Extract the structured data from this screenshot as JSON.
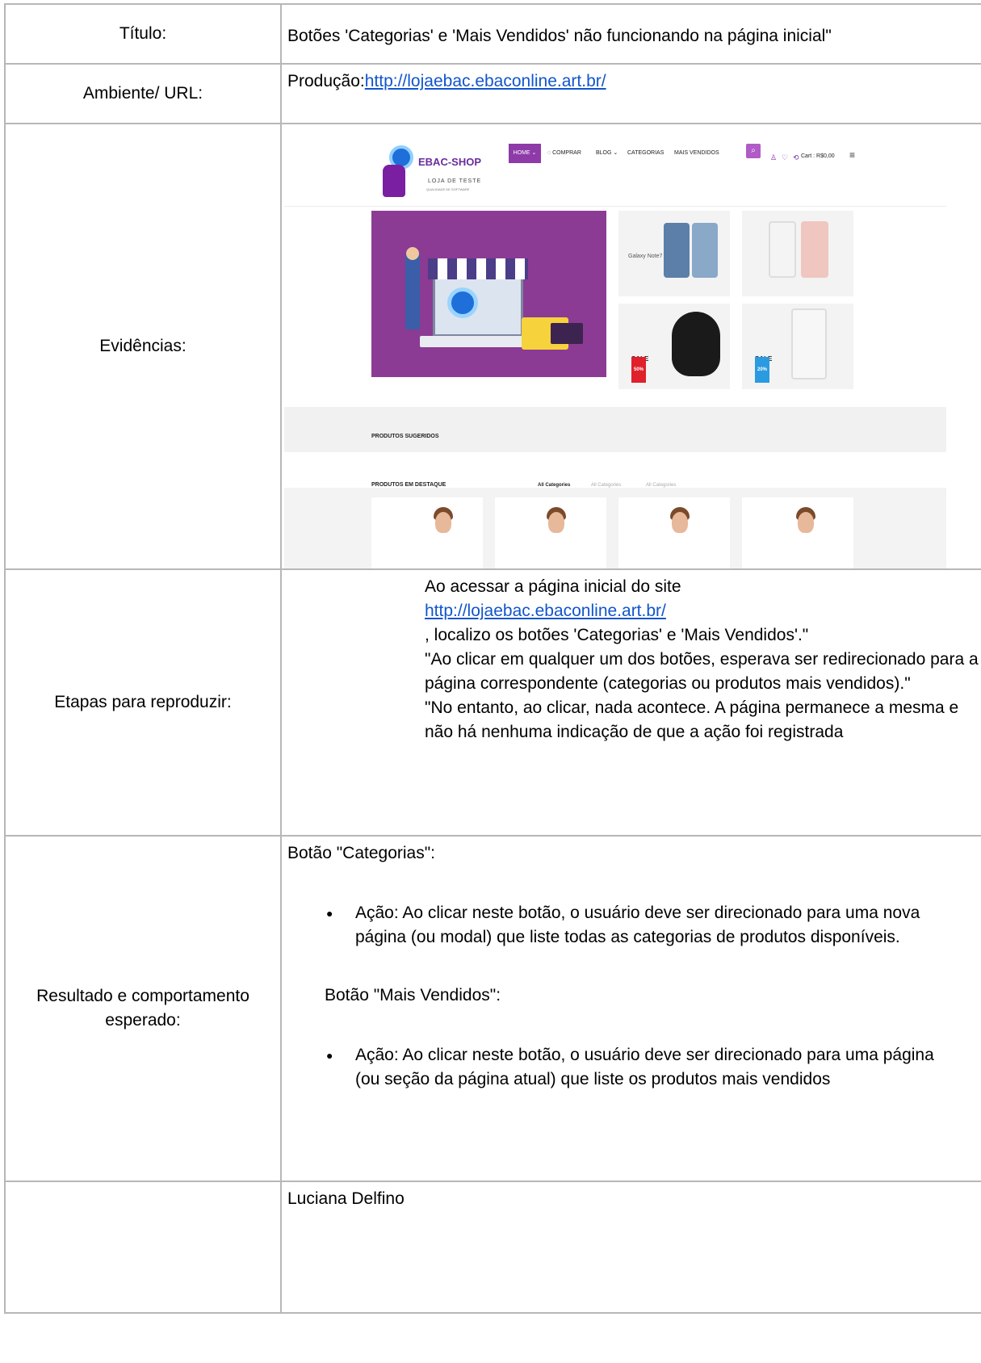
{
  "rows": {
    "title": {
      "label": "Título:",
      "value": "Botões 'Categorias' e 'Mais Vendidos' não funcionando na página inicial\""
    },
    "environment": {
      "label": "Ambiente/ URL:",
      "prefix": "Produção:",
      "url": "http://lojaebac.ebaconline.art.br/"
    },
    "evidence": {
      "label": "Evidências:"
    },
    "steps": {
      "label": "Etapas para reproduzir:",
      "line1": "Ao acessar a página inicial do site",
      "url": "http://lojaebac.ebaconline.art.br/",
      "line2": ", localizo os botões 'Categorias' e 'Mais Vendidos'.\"",
      "line3": "\"Ao clicar em qualquer um dos botões, esperava ser redirecionado para a página correspondente (categorias ou produtos mais vendidos).\"",
      "line4": "\"No entanto, ao clicar, nada acontece. A página permanece a mesma e não há nenhuma indicação de que a ação foi registrada"
    },
    "result": {
      "label": "Resultado e comportamento esperado:",
      "heading1": "Botão \"Categorias\":",
      "bullet1": "Ação: Ao clicar neste botão, o usuário deve ser direcionado para uma nova página (ou modal) que liste todas as categorias de produtos disponíveis.",
      "heading2": "Botão \"Mais Vendidos\":",
      "bullet2": "Ação: Ao clicar neste botão, o usuário deve ser direcionado para uma página (ou seção da página atual) que liste os produtos mais vendidos"
    },
    "author": {
      "label": "",
      "value": "Luciana Delfino"
    }
  },
  "screenshot": {
    "brand": "EBAC-SHOP",
    "tagline": "LOJA DE TESTE",
    "tagline_small": "QUALIDADE DE SOFTWARE",
    "nav": [
      "HOME ⌄",
      "◌ COMPRAR",
      "BLOG ⌄",
      "CATEGORIAS",
      "MAIS VENDIDOS"
    ],
    "cart": "Cart : R$0,00",
    "tiles": {
      "galaxy": "Galaxy Note7",
      "sale1_label": "SALE",
      "sale1_pct": "50%",
      "sale2_label": "SALE",
      "sale2_pct": "20%"
    },
    "suggested": "PRODUTOS SUGERIDOS",
    "featured": "PRODUTOS EM DESTAQUE",
    "categories": [
      "All Categories",
      "All Categories",
      "All Categories"
    ],
    "colors": {
      "purple": "#8b3b93",
      "accent": "#b05bc7",
      "sale_red": "#e0202a",
      "sale_blue": "#2a9be0",
      "link": "#1155cc"
    }
  }
}
